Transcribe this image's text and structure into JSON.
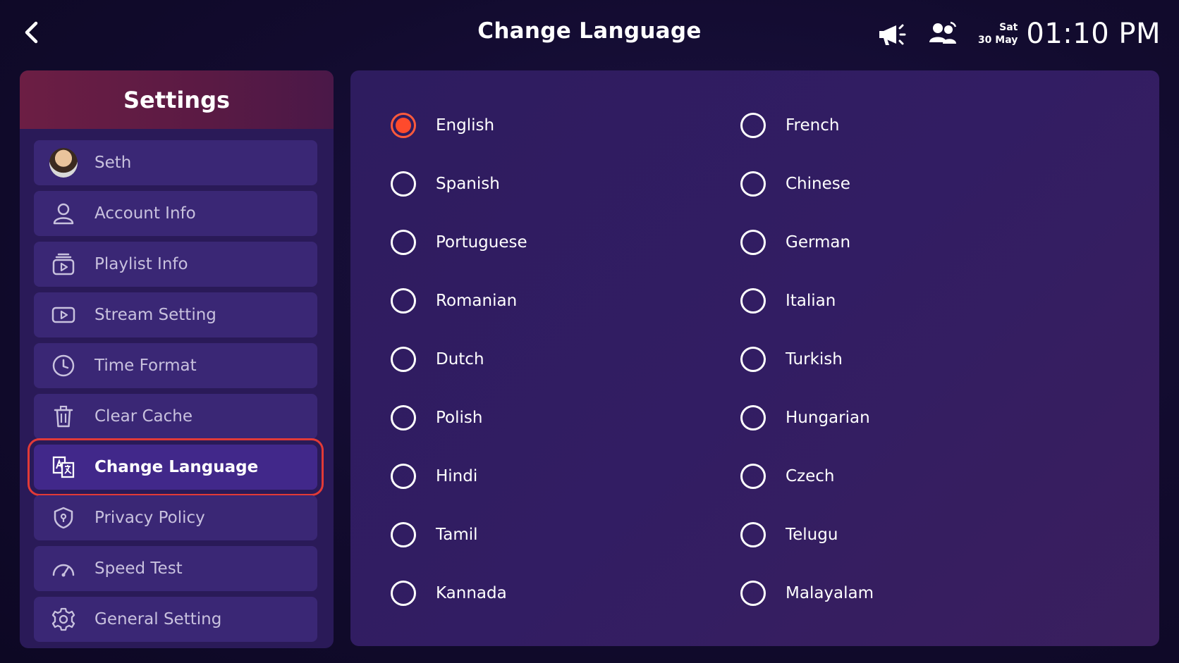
{
  "header": {
    "title": "Change Language",
    "day": "Sat",
    "date": "30 May",
    "time": "01:10 PM"
  },
  "sidebar": {
    "title": "Settings",
    "items": [
      {
        "label": "Seth",
        "icon": "avatar"
      },
      {
        "label": "Account Info",
        "icon": "user-icon"
      },
      {
        "label": "Playlist Info",
        "icon": "playlist-icon"
      },
      {
        "label": "Stream Setting",
        "icon": "play-box-icon"
      },
      {
        "label": "Time Format",
        "icon": "clock-icon"
      },
      {
        "label": "Clear Cache",
        "icon": "trash-icon"
      },
      {
        "label": "Change Language",
        "icon": "translate-icon",
        "active": true
      },
      {
        "label": "Privacy Policy",
        "icon": "shield-icon"
      },
      {
        "label": "Speed Test",
        "icon": "speedometer-icon"
      },
      {
        "label": "General Setting",
        "icon": "gear-icon"
      }
    ]
  },
  "languages": {
    "selected": "English",
    "options": [
      "English",
      "French",
      "Spanish",
      "Chinese",
      "Portuguese",
      "German",
      "Romanian",
      "Italian",
      "Dutch",
      "Turkish",
      "Polish",
      "Hungarian",
      "Hindi",
      "Czech",
      "Tamil",
      "Telugu",
      "Kannada",
      "Malayalam"
    ]
  },
  "colors": {
    "accent": "#ff4a2c",
    "active_outline": "#e23a37",
    "sidebar_header": "#6c1e44",
    "menu_item": "#3a2775"
  }
}
